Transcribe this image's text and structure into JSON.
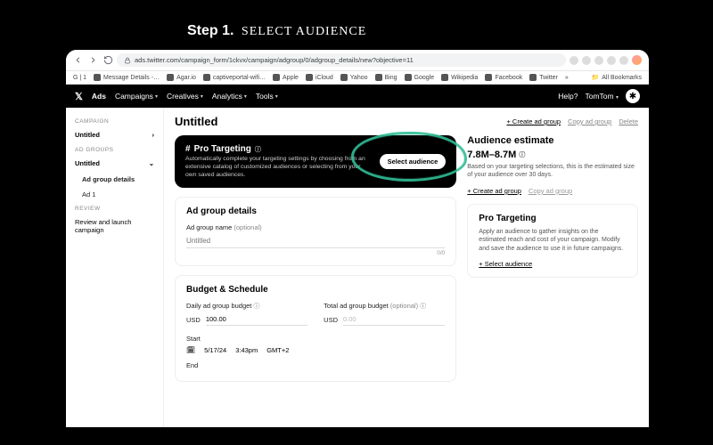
{
  "caption": {
    "step": "Step 1.",
    "title": "Select Audience"
  },
  "urlbar": {
    "text": "ads.twitter.com/campaign_form/1ckvx/campaign/adgroup/0/adgroup_details/new?objective=11"
  },
  "bookmarks": {
    "items": [
      "Message Details -…",
      "Agar.io",
      "captiveportal-wifi…",
      "Apple",
      "iCloud",
      "Yahoo",
      "Bing",
      "Google",
      "Wikipedia",
      "Facebook",
      "Twitter"
    ],
    "prefix": "G | 1",
    "more": "»",
    "all": "All Bookmarks"
  },
  "appbar": {
    "brand": "Ads",
    "menu": [
      "Campaigns",
      "Creatives",
      "Analytics",
      "Tools"
    ],
    "help": "Help?",
    "user": "TomTom"
  },
  "sidebar": {
    "g1_label": "CAMPAIGN",
    "g1_item": "Untitled",
    "g2_label": "AD GROUPS",
    "g2_item": "Untitled",
    "g2_sub1": "Ad group details",
    "g2_sub2": "Ad 1",
    "g3_label": "REVIEW",
    "g3_item": "Review and launch campaign"
  },
  "main": {
    "title": "Untitled",
    "actions": {
      "create": "+  Create ad group",
      "copy": "Copy ad group",
      "delete": "Delete"
    }
  },
  "banner": {
    "heading": "Pro Targeting",
    "body": "Automatically complete your targeting settings by choosing from an extensive catalog of customized audiences or selecting from your own saved audiences.",
    "cta": "Select audience"
  },
  "details": {
    "heading": "Ad group details",
    "name_label": "Ad group name",
    "name_optional": "(optional)",
    "name_placeholder": "Untitled",
    "counter": "0/0"
  },
  "budget": {
    "heading": "Budget & Schedule",
    "daily_label": "Daily ad group budget",
    "total_label": "Total ad group budget",
    "total_optional": "(optional)",
    "currency": "USD",
    "daily_value": "100.00",
    "total_value": "0.00",
    "start_label": "Start",
    "start_date": "5/17/24",
    "start_time": "3:43pm",
    "tz": "GMT+2",
    "end_label": "End"
  },
  "estimate": {
    "heading": "Audience estimate",
    "range": "7.8M–8.7M",
    "desc": "Based on your targeting selections, this is the estimated size of your audience over 30 days.",
    "create": "+  Create ad group",
    "copy": "Copy ad group"
  },
  "pro": {
    "heading": "Pro Targeting",
    "body": "Apply an audience to gather insights on the estimated reach and cost of your campaign. Modify and save the audience to use it in future campaigns.",
    "cta": "+  Select audience"
  }
}
